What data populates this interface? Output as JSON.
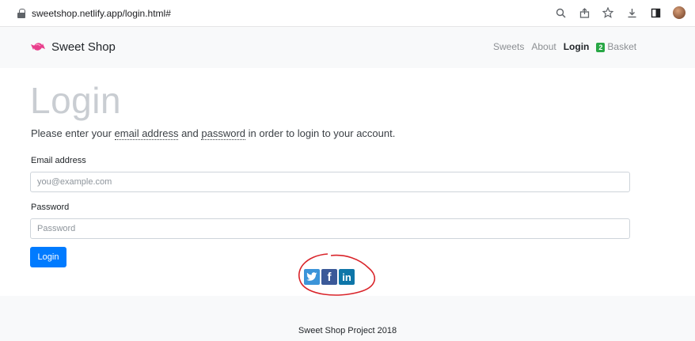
{
  "browser": {
    "url": "sweetshop.netlify.app/login.html#",
    "icons": [
      "lock-icon",
      "zoom-icon",
      "share-icon",
      "bookmark-star-icon",
      "download-icon",
      "side-panel-icon",
      "profile-avatar"
    ]
  },
  "navbar": {
    "brand": "Sweet Shop",
    "links": [
      {
        "label": "Sweets",
        "active": false
      },
      {
        "label": "About",
        "active": false
      },
      {
        "label": "Login",
        "active": true
      },
      {
        "label": "Basket",
        "active": false,
        "badge": "2"
      }
    ]
  },
  "main": {
    "title": "Login",
    "lead_before": "Please enter your ",
    "lead_email": "email address",
    "lead_mid": " and ",
    "lead_password": "password",
    "lead_after": " in order to login to your account.",
    "email_label": "Email address",
    "email_placeholder": "you@example.com",
    "password_label": "Password",
    "password_placeholder": "Password",
    "login_button": "Login"
  },
  "social": {
    "icons": [
      "twitter-icon",
      "facebook-icon",
      "linkedin-icon"
    ],
    "facebook_glyph": "f",
    "linkedin_glyph": "in",
    "annotation_color": "#d9242a"
  },
  "footer": {
    "text": "Sweet Shop Project 2018"
  },
  "colors": {
    "primary": "#007bff",
    "badge": "#28a745",
    "navbar_bg": "#f8f9fa"
  }
}
